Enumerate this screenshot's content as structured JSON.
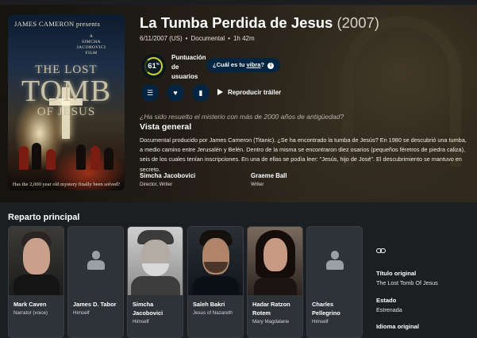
{
  "poster": {
    "credit": "JAMES CAMERON presents",
    "film_line1": "A",
    "film_line2": "SIMCHA",
    "film_line3": "JACOBOVICI",
    "film_line4": "FILM",
    "title_line1": "THE LOST",
    "title_line2": "TOMB",
    "title_line3": "OF JESUS",
    "tagline": "Has the 2,000 year old mystery finally been solved?"
  },
  "movie": {
    "title": "La Tumba Perdida de Jesus",
    "year": "(2007)",
    "release": "6/11/2007 (US)",
    "genre": "Documental",
    "runtime": "1h 42m",
    "dot": "•"
  },
  "score": {
    "value": "61",
    "unit": "%",
    "percent": 61,
    "label_line1": "Puntuación",
    "label_line2": "de",
    "label_line3": "usuarios",
    "ring_color": "#d2d531"
  },
  "vibe": {
    "prefix": "¿Cuál es tu ",
    "link": "vibra",
    "suffix": "?",
    "icon": "i"
  },
  "actions": {
    "list_icon": "list-icon",
    "fav_icon": "heart-icon",
    "watchlist_icon": "bookmark-icon",
    "trailer_label": "Reproducir tráiler"
  },
  "tagline": "¿Ha sido resuelto el misterio con más de 2000 años de antigüedad?",
  "overview": {
    "heading": "Vista general",
    "text": "Documental producido por James Cameron (Titanic). ¿Se ha encontrado la tumba de Jesús? En 1980 se descubrió una tumba, a medio camino entre Jerusalén y Belén. Dentro de la misma se encontraron diez osarios (pequeños féretros de piedra caliza), seis de los cuales tenían inscripciones. En una de ellas se podía leer: \"Jesús, hijo de José\". El descubrimiento se mantuvo en secreto."
  },
  "crew": [
    {
      "name": "Simcha Jacobovici",
      "role": "Director, Writer"
    },
    {
      "name": "Graeme Ball",
      "role": "Writer"
    }
  ],
  "cast": {
    "heading": "Reparto principal",
    "members": [
      {
        "name_line1": "Mark Caven",
        "name_line2": "",
        "role": "Narrator (voice)"
      },
      {
        "name_line1": "James D. Tabor",
        "name_line2": "",
        "role": "Himself"
      },
      {
        "name_line1": "Simcha",
        "name_line2": "Jacobovici",
        "role": "Himself"
      },
      {
        "name_line1": "Saleh Bakri",
        "name_line2": "",
        "role": "Jesus of Nazareth"
      },
      {
        "name_line1": "Hadar Ratzon",
        "name_line2": "Rotem",
        "role": "Mary Magdalane"
      },
      {
        "name_line1": "Charles",
        "name_line2": "Pellegrino",
        "role": "Himself"
      }
    ]
  },
  "facts": {
    "link_icon": "link-icon",
    "original_title_label": "Título original",
    "original_title": "The Lost Tomb Of Jesus",
    "status_label": "Estado",
    "status": "Estrenada",
    "language_label": "Idioma original"
  }
}
